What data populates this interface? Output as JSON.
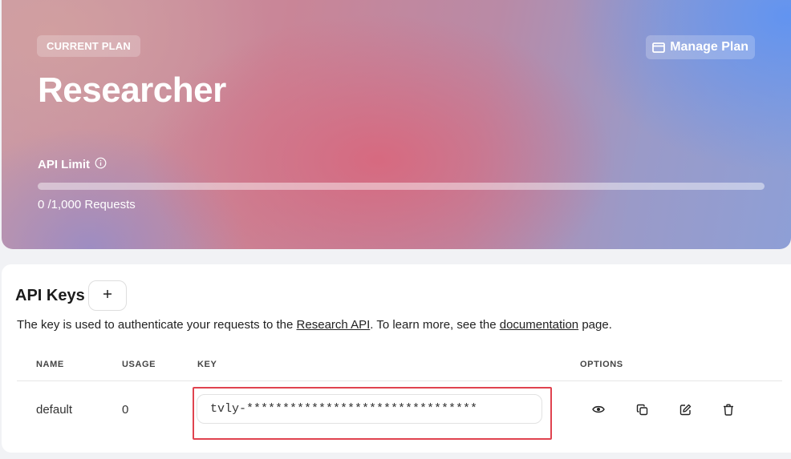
{
  "plan": {
    "badge": "CURRENT PLAN",
    "name": "Researcher",
    "manage_label": "Manage Plan",
    "limit_label": "API Limit",
    "usage_fraction": 0,
    "requests_text": "0 /1,000 Requests"
  },
  "api_keys": {
    "title": "API Keys",
    "description_prefix": "The key is used to authenticate your requests to the ",
    "research_api_link": "Research API",
    "description_middle": ". To learn more, see the ",
    "documentation_link": "documentation",
    "description_suffix": " page.",
    "columns": {
      "name": "NAME",
      "usage": "USAGE",
      "key": "KEY",
      "options": "OPTIONS"
    },
    "rows": [
      {
        "name": "default",
        "usage": "0",
        "key": "tvly-********************************"
      }
    ]
  },
  "icons": {
    "manage": "card-icon",
    "limit_info": "info-icon",
    "add": "plus-icon",
    "view": "eye-icon",
    "copy": "copy-icon",
    "edit": "edit-icon",
    "delete": "trash-icon"
  },
  "colors": {
    "highlight": "#e0434f"
  }
}
